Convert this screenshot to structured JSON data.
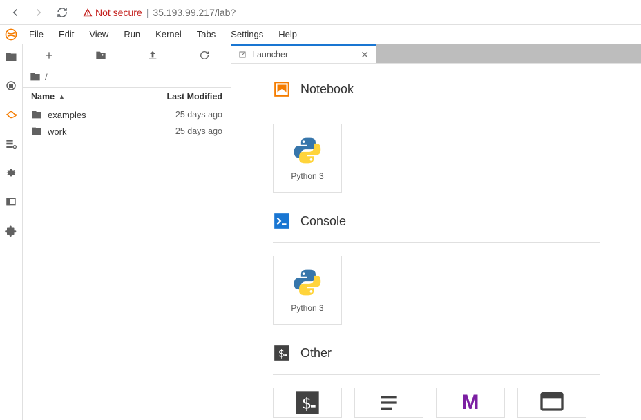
{
  "browser": {
    "not_secure": "Not secure",
    "url": "35.193.99.217/lab?"
  },
  "menu": {
    "file": "File",
    "edit": "Edit",
    "view": "View",
    "run": "Run",
    "kernel": "Kernel",
    "tabs": "Tabs",
    "settings": "Settings",
    "help": "Help"
  },
  "filebrowser": {
    "breadcrumb_root": "/",
    "col_name": "Name",
    "col_modified": "Last Modified",
    "items": [
      {
        "name": "examples",
        "modified": "25 days ago"
      },
      {
        "name": "work",
        "modified": "25 days ago"
      }
    ]
  },
  "tab": {
    "title": "Launcher"
  },
  "launcher": {
    "sections": {
      "notebook": {
        "title": "Notebook",
        "cards": [
          {
            "label": "Python 3"
          }
        ]
      },
      "console": {
        "title": "Console",
        "cards": [
          {
            "label": "Python 3"
          }
        ]
      },
      "other": {
        "title": "Other"
      }
    }
  }
}
